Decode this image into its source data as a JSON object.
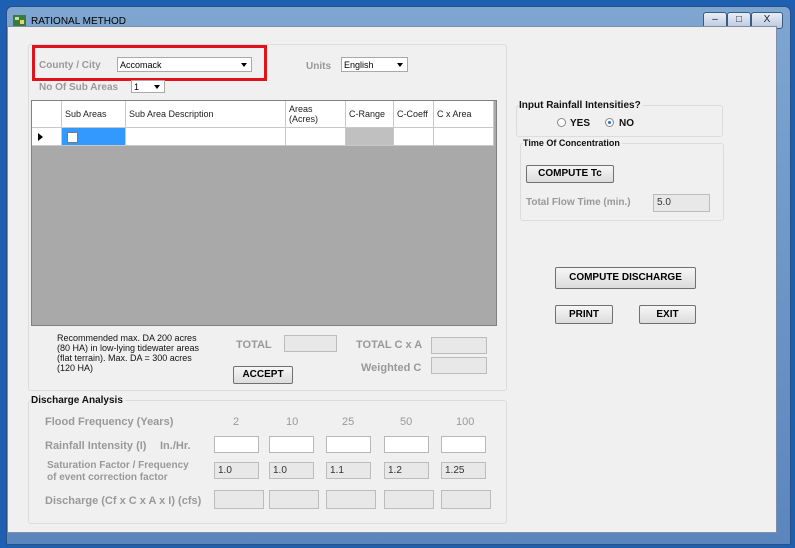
{
  "window": {
    "title": "RATIONAL METHOD",
    "minimize": "–",
    "maximize": "□",
    "close": "X"
  },
  "location": {
    "county_label": "County / City",
    "county_value": "Accomack",
    "units_label": "Units",
    "units_value": "English",
    "subareas_label": "No Of Sub Areas",
    "subareas_value": "1"
  },
  "grid": {
    "headers": [
      "Sub Areas",
      "Sub Area Description",
      "Areas (Acres)",
      "C-Range",
      "C-Coeff",
      "C x Area"
    ]
  },
  "notes": {
    "recommendation": "Recommended max. DA 200 acres (80 HA) in low-lying tidewater areas (flat terrain). Max. DA = 300 acres (120 HA)"
  },
  "totals": {
    "total_label": "TOTAL",
    "total_cxa_label": "TOTAL C x A",
    "weighted_c_label": "Weighted C",
    "accept_button": "ACCEPT"
  },
  "rainfall": {
    "title": "Input Rainfall Intensities?",
    "yes": "YES",
    "no": "NO",
    "selected": "NO"
  },
  "tc": {
    "title": "Time Of Concentration",
    "compute_button": "COMPUTE Tc",
    "flow_label": "Total Flow Time (min.)",
    "flow_value": "5.0"
  },
  "actions": {
    "compute_discharge": "COMPUTE DISCHARGE",
    "print": "PRINT",
    "exit": "EXIT"
  },
  "discharge": {
    "title": "Discharge Analysis",
    "flood_label": "Flood Frequency (Years)",
    "frequencies": [
      "2",
      "10",
      "25",
      "50",
      "100"
    ],
    "intensity_label": "Rainfall Intensity (I)",
    "intensity_unit": "In./Hr.",
    "saturation_label_1": "Saturation Factor / Frequency",
    "saturation_label_2": "of event correction factor",
    "saturation_values": [
      "1.0",
      "1.0",
      "1.1",
      "1.2",
      "1.25"
    ],
    "discharge_label": "Discharge (Cf x C x A x I) (cfs)"
  }
}
